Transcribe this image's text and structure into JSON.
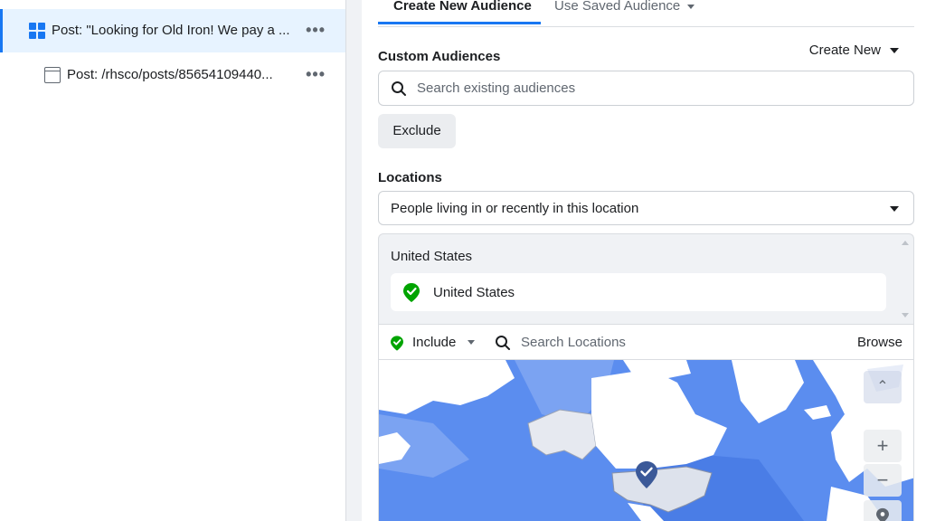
{
  "sidebar": {
    "items": [
      {
        "label": "Post: \"Looking for Old Iron! We pay a ...",
        "icon": "grid-icon",
        "selected": true
      },
      {
        "label": "Post: /rhsco/posts/85654109440...",
        "icon": "page-icon",
        "selected": false
      }
    ],
    "more_glyph": "•••"
  },
  "tabs": {
    "create_new": "Create New Audience",
    "use_saved": "Use Saved Audience"
  },
  "custom_audiences": {
    "label": "Custom Audiences",
    "create_new_label": "Create New",
    "search_placeholder": "Search existing audiences",
    "exclude_label": "Exclude"
  },
  "locations": {
    "label": "Locations",
    "type_select": "People living in or recently in this location",
    "group_title": "United States",
    "selected": [
      {
        "name": "United States",
        "status": "included"
      }
    ],
    "include_label": "Include",
    "search_placeholder": "Search Locations",
    "browse_label": "Browse"
  },
  "map": {
    "controls": {
      "zoom_in": "+",
      "zoom_out": "−",
      "collapse": "⌃"
    }
  },
  "colors": {
    "accent": "#1877f2",
    "include_green": "#00a400",
    "map_ocean": "#5b8def",
    "map_land": "#ffffff",
    "selected_bg": "#e7f3ff",
    "pin_dark": "#3b5998"
  }
}
